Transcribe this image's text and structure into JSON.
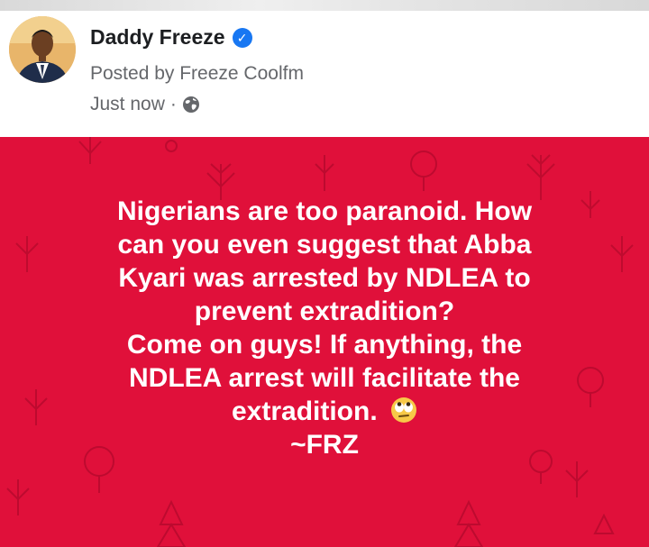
{
  "post": {
    "author_name": "Daddy Freeze",
    "posted_by": "Posted by Freeze Coolfm",
    "timestamp": "Just now",
    "separator": "·",
    "privacy_icon": "globe-icon",
    "verified_icon": "verified-badge-icon",
    "verified_glyph": "✓"
  },
  "card": {
    "background_color": "#e0103a",
    "text_color": "#ffffff",
    "lines": [
      "Nigerians are too paranoid. How",
      "can you even suggest that Abba",
      "Kyari was arrested by NDLEA to",
      "prevent extradition?",
      "Come on guys! If anything, the",
      "NDLEA arrest will facilitate the",
      "extradition.",
      "~FRZ"
    ],
    "emoji": "eye-roll-emoji"
  }
}
